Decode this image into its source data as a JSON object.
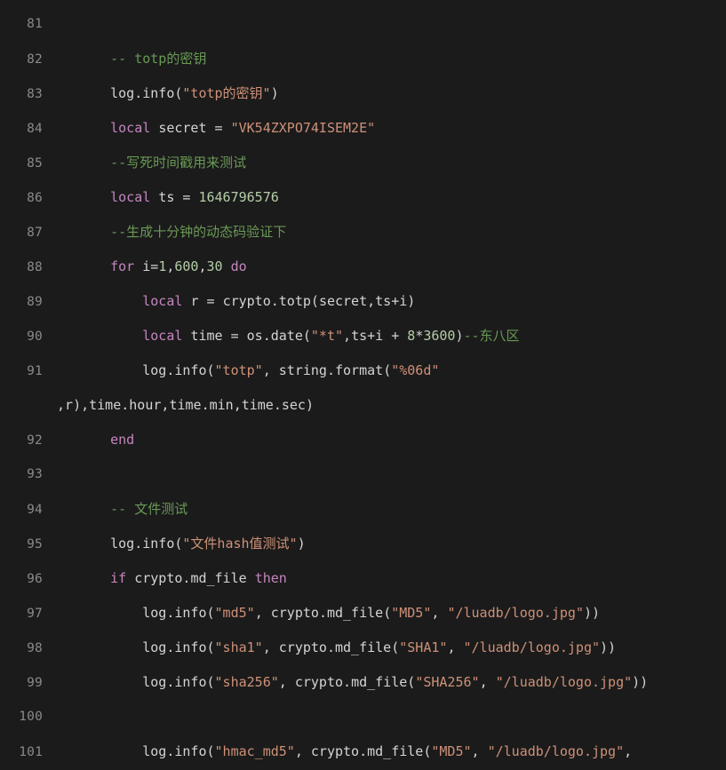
{
  "editor": {
    "language": "lua",
    "theme": "dark-plus",
    "background_color": "#1b1b1b",
    "gutter_color": "#8a8a8a",
    "colors": {
      "plain": "#d4d4d4",
      "comment": "#6a9955",
      "keyword": "#c586c0",
      "variable": "#9cdcfe",
      "function": "#9cdcfe",
      "string": "#ce9178",
      "number": "#b5cea8"
    },
    "first_visible_line": 81,
    "last_visible_line": 101,
    "lines": [
      {
        "number": "81",
        "wrapped": false,
        "tokens": []
      },
      {
        "number": "82",
        "wrapped": false,
        "tokens": [
          {
            "t": "    ",
            "c": "plain"
          },
          {
            "t": "-- totp的密钥",
            "c": "comment"
          }
        ]
      },
      {
        "number": "83",
        "wrapped": false,
        "tokens": [
          {
            "t": "    ",
            "c": "plain"
          },
          {
            "t": "log",
            "c": "variable"
          },
          {
            "t": ".",
            "c": "plain"
          },
          {
            "t": "info",
            "c": "function"
          },
          {
            "t": "(",
            "c": "plain"
          },
          {
            "t": "\"totp的密钥\"",
            "c": "string"
          },
          {
            "t": ")",
            "c": "plain"
          }
        ]
      },
      {
        "number": "84",
        "wrapped": false,
        "tokens": [
          {
            "t": "    ",
            "c": "plain"
          },
          {
            "t": "local",
            "c": "keyword"
          },
          {
            "t": " ",
            "c": "plain"
          },
          {
            "t": "secret",
            "c": "variable"
          },
          {
            "t": " = ",
            "c": "plain"
          },
          {
            "t": "\"VK54ZXPO74ISEM2E\"",
            "c": "string"
          }
        ]
      },
      {
        "number": "85",
        "wrapped": false,
        "tokens": [
          {
            "t": "    ",
            "c": "plain"
          },
          {
            "t": "--写死时间戳用来测试",
            "c": "comment"
          }
        ]
      },
      {
        "number": "86",
        "wrapped": false,
        "tokens": [
          {
            "t": "    ",
            "c": "plain"
          },
          {
            "t": "local",
            "c": "keyword"
          },
          {
            "t": " ",
            "c": "plain"
          },
          {
            "t": "ts",
            "c": "variable"
          },
          {
            "t": " = ",
            "c": "plain"
          },
          {
            "t": "1646796576",
            "c": "number"
          }
        ]
      },
      {
        "number": "87",
        "wrapped": false,
        "tokens": [
          {
            "t": "    ",
            "c": "plain"
          },
          {
            "t": "--生成十分钟的动态码验证下",
            "c": "comment"
          }
        ]
      },
      {
        "number": "88",
        "wrapped": false,
        "tokens": [
          {
            "t": "    ",
            "c": "plain"
          },
          {
            "t": "for",
            "c": "keyword"
          },
          {
            "t": " ",
            "c": "plain"
          },
          {
            "t": "i",
            "c": "variable"
          },
          {
            "t": "=",
            "c": "plain"
          },
          {
            "t": "1",
            "c": "number"
          },
          {
            "t": ",",
            "c": "plain"
          },
          {
            "t": "600",
            "c": "number"
          },
          {
            "t": ",",
            "c": "plain"
          },
          {
            "t": "30",
            "c": "number"
          },
          {
            "t": " ",
            "c": "plain"
          },
          {
            "t": "do",
            "c": "keyword"
          }
        ]
      },
      {
        "number": "89",
        "wrapped": false,
        "tokens": [
          {
            "t": "        ",
            "c": "plain"
          },
          {
            "t": "local",
            "c": "keyword"
          },
          {
            "t": " ",
            "c": "plain"
          },
          {
            "t": "r",
            "c": "variable"
          },
          {
            "t": " = ",
            "c": "plain"
          },
          {
            "t": "crypto",
            "c": "variable"
          },
          {
            "t": ".",
            "c": "plain"
          },
          {
            "t": "totp",
            "c": "function"
          },
          {
            "t": "(",
            "c": "plain"
          },
          {
            "t": "secret",
            "c": "variable"
          },
          {
            "t": ",",
            "c": "plain"
          },
          {
            "t": "ts",
            "c": "variable"
          },
          {
            "t": "+",
            "c": "plain"
          },
          {
            "t": "i",
            "c": "variable"
          },
          {
            "t": ")",
            "c": "plain"
          }
        ]
      },
      {
        "number": "90",
        "wrapped": false,
        "tokens": [
          {
            "t": "        ",
            "c": "plain"
          },
          {
            "t": "local",
            "c": "keyword"
          },
          {
            "t": " ",
            "c": "plain"
          },
          {
            "t": "time",
            "c": "variable"
          },
          {
            "t": " = ",
            "c": "plain"
          },
          {
            "t": "os",
            "c": "variable"
          },
          {
            "t": ".",
            "c": "plain"
          },
          {
            "t": "date",
            "c": "function"
          },
          {
            "t": "(",
            "c": "plain"
          },
          {
            "t": "\"*t\"",
            "c": "string"
          },
          {
            "t": ",",
            "c": "plain"
          },
          {
            "t": "ts",
            "c": "variable"
          },
          {
            "t": "+",
            "c": "plain"
          },
          {
            "t": "i",
            "c": "variable"
          },
          {
            "t": " + ",
            "c": "plain"
          },
          {
            "t": "8",
            "c": "number"
          },
          {
            "t": "*",
            "c": "plain"
          },
          {
            "t": "3600",
            "c": "number"
          },
          {
            "t": ")",
            "c": "plain"
          },
          {
            "t": "--东八区",
            "c": "comment"
          }
        ]
      },
      {
        "number": "91",
        "wrapped": false,
        "tokens": [
          {
            "t": "        ",
            "c": "plain"
          },
          {
            "t": "log",
            "c": "variable"
          },
          {
            "t": ".",
            "c": "plain"
          },
          {
            "t": "info",
            "c": "function"
          },
          {
            "t": "(",
            "c": "plain"
          },
          {
            "t": "\"totp\"",
            "c": "string"
          },
          {
            "t": ", ",
            "c": "plain"
          },
          {
            "t": "string",
            "c": "variable"
          },
          {
            "t": ".",
            "c": "plain"
          },
          {
            "t": "format",
            "c": "function"
          },
          {
            "t": "(",
            "c": "plain"
          },
          {
            "t": "\"%06d\"",
            "c": "string"
          }
        ]
      },
      {
        "number": "91",
        "wrapped": true,
        "tokens": [
          {
            "t": ",",
            "c": "plain"
          },
          {
            "t": "r",
            "c": "variable"
          },
          {
            "t": "),",
            "c": "plain"
          },
          {
            "t": "time",
            "c": "variable"
          },
          {
            "t": ".",
            "c": "plain"
          },
          {
            "t": "hour",
            "c": "variable"
          },
          {
            "t": ",",
            "c": "plain"
          },
          {
            "t": "time",
            "c": "variable"
          },
          {
            "t": ".",
            "c": "plain"
          },
          {
            "t": "min",
            "c": "variable"
          },
          {
            "t": ",",
            "c": "plain"
          },
          {
            "t": "time",
            "c": "variable"
          },
          {
            "t": ".",
            "c": "plain"
          },
          {
            "t": "sec",
            "c": "variable"
          },
          {
            "t": ")",
            "c": "plain"
          }
        ]
      },
      {
        "number": "92",
        "wrapped": false,
        "tokens": [
          {
            "t": "    ",
            "c": "plain"
          },
          {
            "t": "end",
            "c": "keyword"
          }
        ]
      },
      {
        "number": "93",
        "wrapped": false,
        "tokens": []
      },
      {
        "number": "94",
        "wrapped": false,
        "tokens": [
          {
            "t": "    ",
            "c": "plain"
          },
          {
            "t": "-- 文件测试",
            "c": "comment"
          }
        ]
      },
      {
        "number": "95",
        "wrapped": false,
        "tokens": [
          {
            "t": "    ",
            "c": "plain"
          },
          {
            "t": "log",
            "c": "variable"
          },
          {
            "t": ".",
            "c": "plain"
          },
          {
            "t": "info",
            "c": "function"
          },
          {
            "t": "(",
            "c": "plain"
          },
          {
            "t": "\"文件hash值测试\"",
            "c": "string"
          },
          {
            "t": ")",
            "c": "plain"
          }
        ]
      },
      {
        "number": "96",
        "wrapped": false,
        "tokens": [
          {
            "t": "    ",
            "c": "plain"
          },
          {
            "t": "if",
            "c": "keyword"
          },
          {
            "t": " ",
            "c": "plain"
          },
          {
            "t": "crypto",
            "c": "variable"
          },
          {
            "t": ".",
            "c": "plain"
          },
          {
            "t": "md_file",
            "c": "function"
          },
          {
            "t": " ",
            "c": "plain"
          },
          {
            "t": "then",
            "c": "keyword"
          }
        ]
      },
      {
        "number": "97",
        "wrapped": false,
        "tokens": [
          {
            "t": "        ",
            "c": "plain"
          },
          {
            "t": "log",
            "c": "variable"
          },
          {
            "t": ".",
            "c": "plain"
          },
          {
            "t": "info",
            "c": "function"
          },
          {
            "t": "(",
            "c": "plain"
          },
          {
            "t": "\"md5\"",
            "c": "string"
          },
          {
            "t": ", ",
            "c": "plain"
          },
          {
            "t": "crypto",
            "c": "variable"
          },
          {
            "t": ".",
            "c": "plain"
          },
          {
            "t": "md_file",
            "c": "function"
          },
          {
            "t": "(",
            "c": "plain"
          },
          {
            "t": "\"MD5\"",
            "c": "string"
          },
          {
            "t": ", ",
            "c": "plain"
          },
          {
            "t": "\"/luadb/logo.jpg\"",
            "c": "string"
          },
          {
            "t": "))",
            "c": "plain"
          }
        ]
      },
      {
        "number": "98",
        "wrapped": false,
        "tokens": [
          {
            "t": "        ",
            "c": "plain"
          },
          {
            "t": "log",
            "c": "variable"
          },
          {
            "t": ".",
            "c": "plain"
          },
          {
            "t": "info",
            "c": "function"
          },
          {
            "t": "(",
            "c": "plain"
          },
          {
            "t": "\"sha1\"",
            "c": "string"
          },
          {
            "t": ", ",
            "c": "plain"
          },
          {
            "t": "crypto",
            "c": "variable"
          },
          {
            "t": ".",
            "c": "plain"
          },
          {
            "t": "md_file",
            "c": "function"
          },
          {
            "t": "(",
            "c": "plain"
          },
          {
            "t": "\"SHA1\"",
            "c": "string"
          },
          {
            "t": ", ",
            "c": "plain"
          },
          {
            "t": "\"/luadb/logo.jpg\"",
            "c": "string"
          },
          {
            "t": "))",
            "c": "plain"
          }
        ]
      },
      {
        "number": "99",
        "wrapped": false,
        "tokens": [
          {
            "t": "        ",
            "c": "plain"
          },
          {
            "t": "log",
            "c": "variable"
          },
          {
            "t": ".",
            "c": "plain"
          },
          {
            "t": "info",
            "c": "function"
          },
          {
            "t": "(",
            "c": "plain"
          },
          {
            "t": "\"sha256\"",
            "c": "string"
          },
          {
            "t": ", ",
            "c": "plain"
          },
          {
            "t": "crypto",
            "c": "variable"
          },
          {
            "t": ".",
            "c": "plain"
          },
          {
            "t": "md_file",
            "c": "function"
          },
          {
            "t": "(",
            "c": "plain"
          },
          {
            "t": "\"SHA256\"",
            "c": "string"
          },
          {
            "t": ", ",
            "c": "plain"
          },
          {
            "t": "\"/luadb/logo.jpg\"",
            "c": "string"
          },
          {
            "t": "))",
            "c": "plain"
          }
        ]
      },
      {
        "number": "100",
        "wrapped": false,
        "tokens": []
      },
      {
        "number": "101",
        "wrapped": false,
        "tokens": [
          {
            "t": "        ",
            "c": "plain"
          },
          {
            "t": "log",
            "c": "variable"
          },
          {
            "t": ".",
            "c": "plain"
          },
          {
            "t": "info",
            "c": "function"
          },
          {
            "t": "(",
            "c": "plain"
          },
          {
            "t": "\"hmac_md5\"",
            "c": "string"
          },
          {
            "t": ", ",
            "c": "plain"
          },
          {
            "t": "crypto",
            "c": "variable"
          },
          {
            "t": ".",
            "c": "plain"
          },
          {
            "t": "md_file",
            "c": "function"
          },
          {
            "t": "(",
            "c": "plain"
          },
          {
            "t": "\"MD5\"",
            "c": "string"
          },
          {
            "t": ", ",
            "c": "plain"
          },
          {
            "t": "\"/luadb/logo.jpg\"",
            "c": "string"
          },
          {
            "t": ",",
            "c": "plain"
          }
        ]
      }
    ]
  }
}
